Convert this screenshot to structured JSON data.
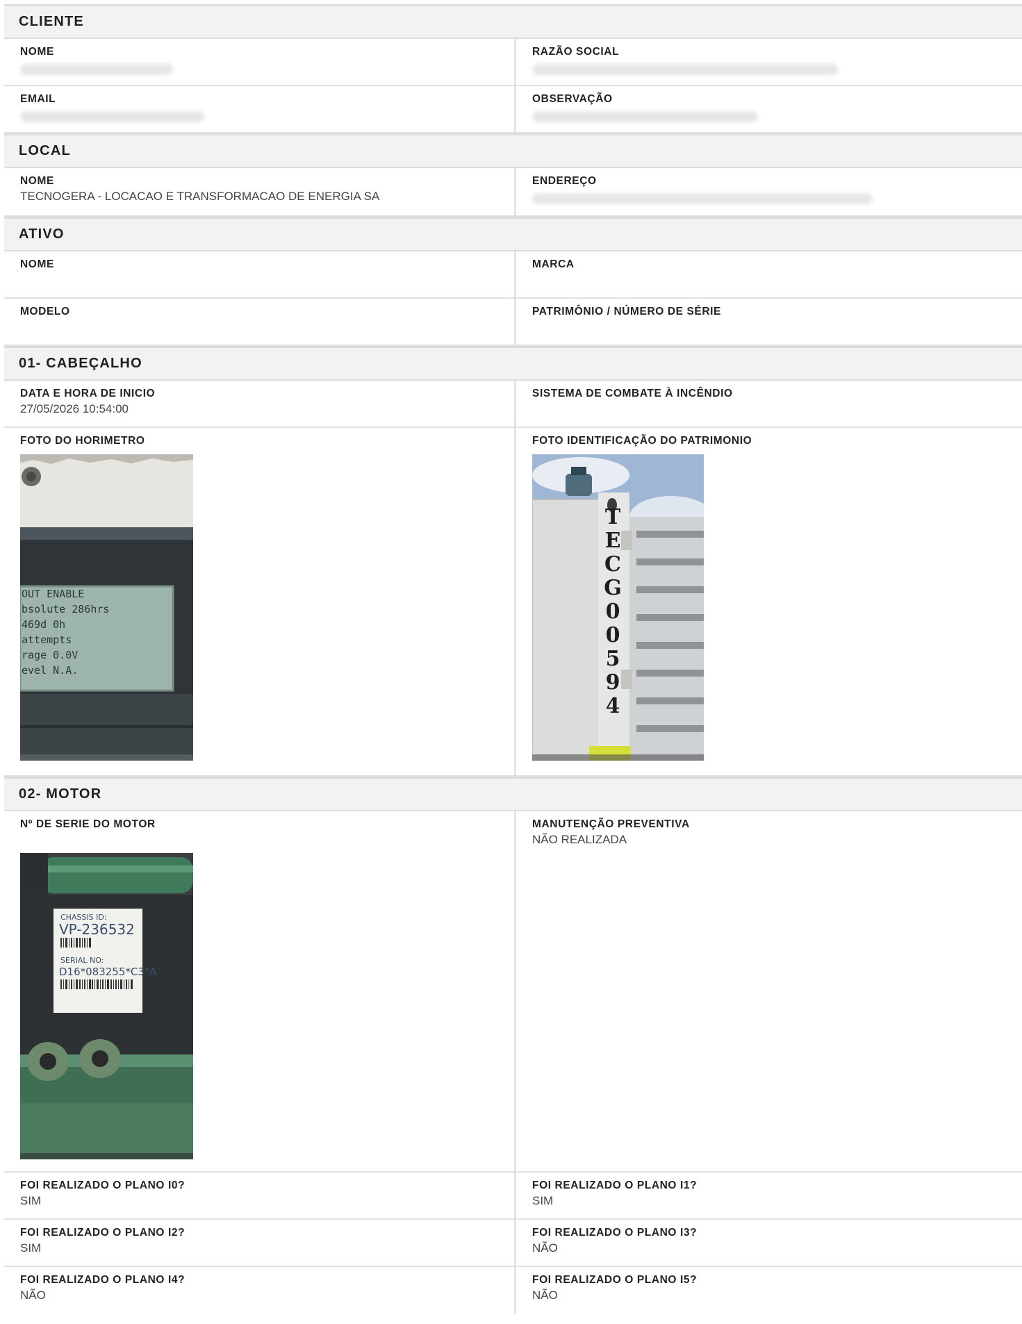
{
  "sections": {
    "cliente": {
      "title": "CLIENTE",
      "nome_label": "NOME",
      "razao_label": "RAZÃO SOCIAL",
      "email_label": "EMAIL",
      "observacao_label": "OBSERVAÇÃO"
    },
    "local": {
      "title": "LOCAL",
      "nome_label": "NOME",
      "nome_value": "TECNOGERA - LOCACAO E TRANSFORMACAO DE ENERGIA SA",
      "endereco_label": "ENDEREÇO"
    },
    "ativo": {
      "title": "ATIVO",
      "nome_label": "NOME",
      "marca_label": "MARCA",
      "modelo_label": "MODELO",
      "patrimonio_label": "PATRIMÔNIO / NÚMERO DE SÉRIE"
    },
    "cabecalho": {
      "title": "01- CABEÇALHO",
      "data_label": "DATA E HORA DE INICIO",
      "data_value": "27/05/2026 10:54:00",
      "sistema_label": "SISTEMA DE COMBATE À INCÊNDIO",
      "foto_horimetro_label": "FOTO DO HORIMETRO",
      "foto_patrimonio_label": "FOTO IDENTIFICAÇÃO DO PATRIMONIO",
      "horimetro_screen": {
        "lines": [
          "OUT ENABLE",
          "bsolute    286hrs",
          "  469d      0h",
          "attempts",
          "rage       0.0V",
          "evel       N.A."
        ]
      },
      "patrimonio_stencil": "TECG00594"
    },
    "motor": {
      "title": "02- MOTOR",
      "serie_label": "Nº DE SERIE DO MOTOR",
      "manutencao_label": "MANUTENÇÃO PREVENTIVA",
      "manutencao_value": "NÃO REALIZADA",
      "plate": {
        "chassis_label": "CHASSIS ID:",
        "chassis_value": "VP-236532",
        "serial_label": "SERIAL NO:",
        "serial_value": "D16*083255*C3*A"
      },
      "planos": [
        {
          "label": "FOI REALIZADO O PLANO I0?",
          "value": "SIM"
        },
        {
          "label": "FOI REALIZADO O PLANO I1?",
          "value": "SIM"
        },
        {
          "label": "FOI REALIZADO O PLANO I2?",
          "value": "SIM"
        },
        {
          "label": "FOI REALIZADO O PLANO I3?",
          "value": "NÃO"
        },
        {
          "label": "FOI REALIZADO O PLANO I4?",
          "value": "NÃO"
        },
        {
          "label": "FOI REALIZADO O PLANO I5?",
          "value": "NÃO"
        }
      ]
    }
  }
}
